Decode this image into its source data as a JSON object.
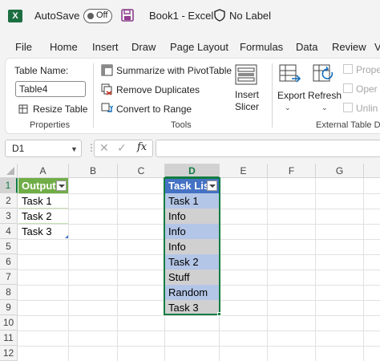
{
  "titlebar": {
    "app_icon": "excel-icon",
    "autosave_label": "AutoSave",
    "autosave_state": "Off",
    "save_icon": "save-icon",
    "doc_title": "Book1  -  Excel",
    "label_icon": "shield-icon",
    "label_text": "No Label"
  },
  "tabs": [
    "File",
    "Home",
    "Insert",
    "Draw",
    "Page Layout",
    "Formulas",
    "Data",
    "Review",
    "V"
  ],
  "ribbon": {
    "properties": {
      "table_name_label": "Table Name:",
      "table_name_value": "Table4",
      "resize_label": "Resize Table",
      "group_title": "Properties"
    },
    "tools": {
      "summarize_label": "Summarize with PivotTable",
      "remove_duplicates_label": "Remove Duplicates",
      "convert_label": "Convert to Range",
      "group_title": "Tools"
    },
    "insert_slicer": {
      "line1": "Insert",
      "line2": "Slicer"
    },
    "external": {
      "export_label": "Export",
      "refresh_label": "Refresh",
      "properties_label": "Prope",
      "open_label": "Oper",
      "unlink_label": "Unlin",
      "group_title": "External Table Da"
    }
  },
  "formula_bar": {
    "name_box": "D1",
    "cancel_icon": "✕",
    "enter_icon": "✓",
    "fx": "fx",
    "formula": ""
  },
  "grid": {
    "columns": [
      "A",
      "B",
      "C",
      "D",
      "E",
      "F",
      "G"
    ],
    "rows": [
      "1",
      "2",
      "3",
      "4",
      "5",
      "6",
      "7",
      "8",
      "9",
      "10",
      "11",
      "12"
    ],
    "output_table": {
      "header": "Output",
      "values": [
        "Task 1",
        "Task 2",
        "Task 3"
      ]
    },
    "task_table": {
      "header": "Task List",
      "values": [
        "Task 1",
        "Info",
        "Info",
        "Info",
        "Task 2",
        "Stuff",
        "Random",
        "Task 3"
      ]
    },
    "selected_cell": "D1"
  },
  "colors": {
    "excel_green": "#107c41",
    "table_blue_header": "#4472c4",
    "table_blue_band": "#b4c6e7",
    "output_green_header": "#70ad47"
  }
}
